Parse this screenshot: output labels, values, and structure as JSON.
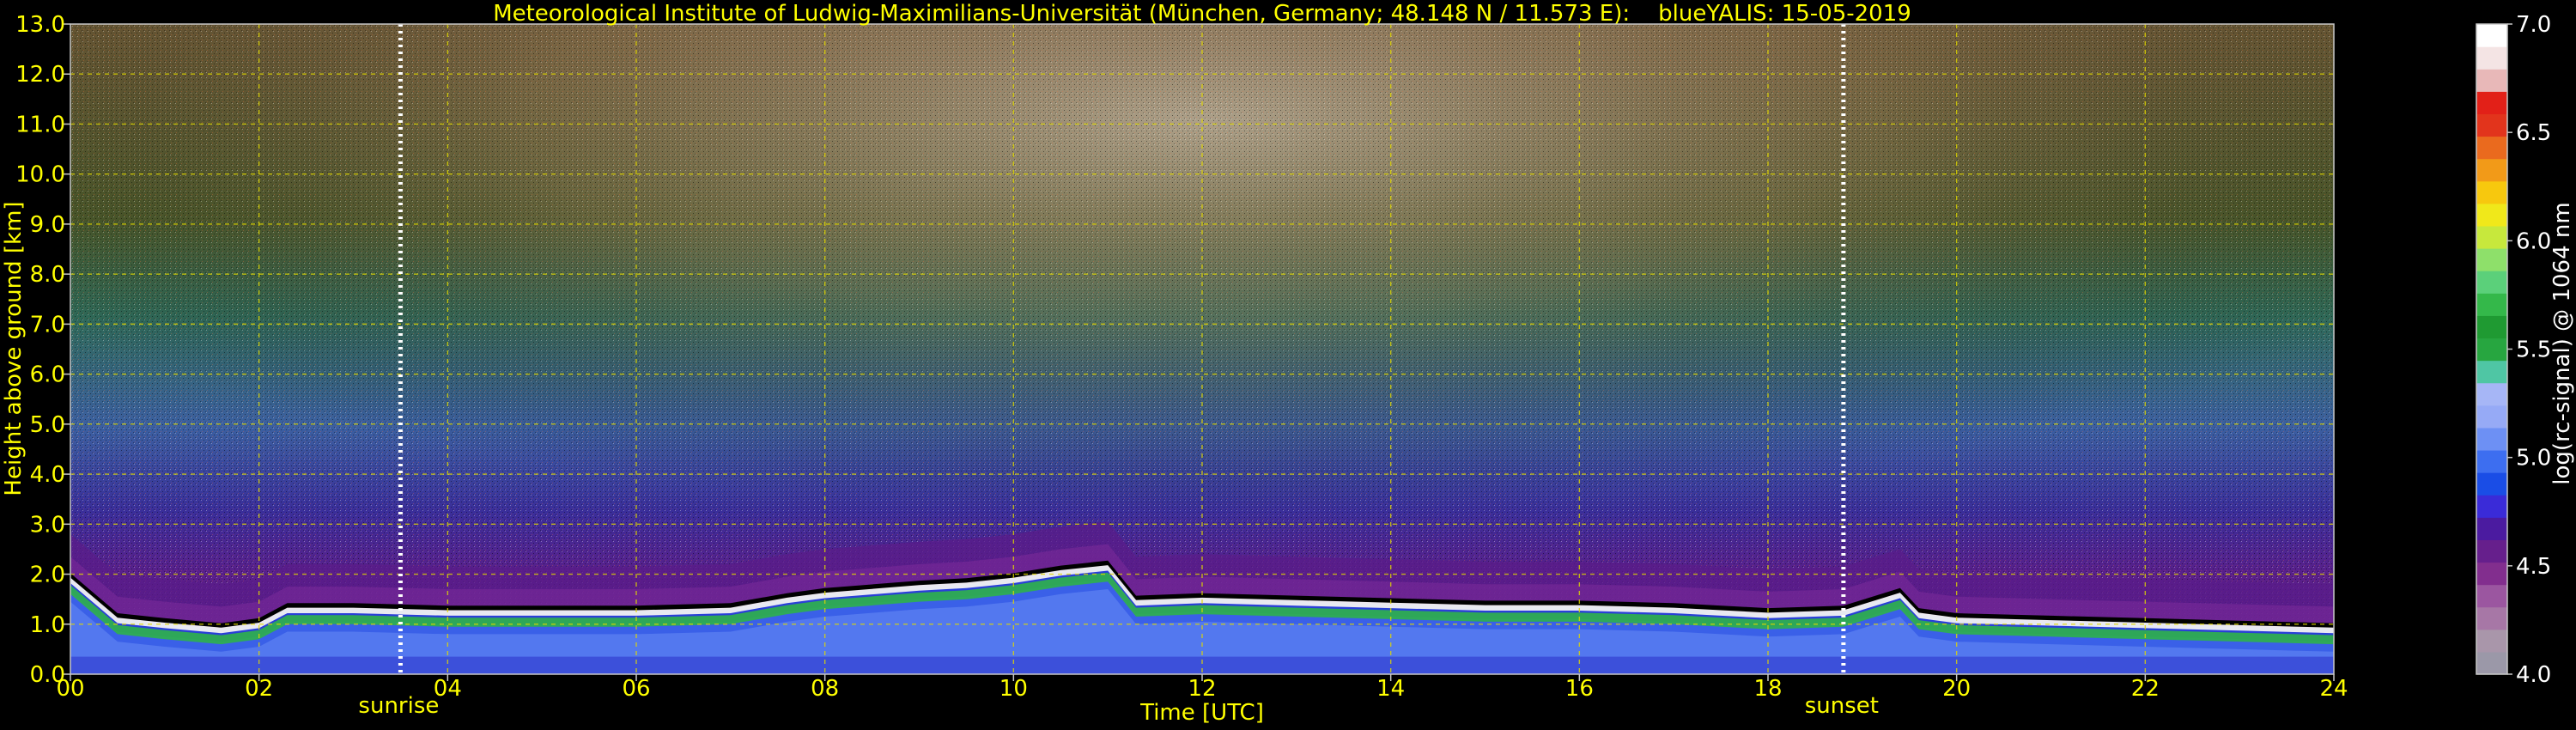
{
  "chart_data": {
    "type": "heatmap",
    "title": "Meteorological Institute of Ludwig-Maximilians-Universität (München, Germany; 48.148 N / 11.573 E):    blueYALIS: 15-05-2019",
    "xlabel": "Time [UTC]",
    "ylabel": "Height above ground [km]",
    "xlim": [
      0,
      24
    ],
    "ylim": [
      0,
      13
    ],
    "x_ticks": [
      "00",
      "02",
      "04",
      "06",
      "08",
      "10",
      "12",
      "14",
      "16",
      "18",
      "20",
      "22",
      "24"
    ],
    "y_ticks": [
      "0.0",
      "1.0",
      "2.0",
      "3.0",
      "4.0",
      "5.0",
      "6.0",
      "7.0",
      "8.0",
      "9.0",
      "10.0",
      "11.0",
      "12.0",
      "13.0"
    ],
    "grid": true,
    "annotations": [
      {
        "text": "sunrise",
        "time": 3.5
      },
      {
        "text": "sunset",
        "time": 18.8
      }
    ],
    "boundary_layer_top_km": [
      [
        0.0,
        1.9
      ],
      [
        0.5,
        1.1
      ],
      [
        1.0,
        1.0
      ],
      [
        1.6,
        0.9
      ],
      [
        2.0,
        1.0
      ],
      [
        2.3,
        1.3
      ],
      [
        3.0,
        1.3
      ],
      [
        4.0,
        1.25
      ],
      [
        5.0,
        1.25
      ],
      [
        6.0,
        1.25
      ],
      [
        7.0,
        1.3
      ],
      [
        7.6,
        1.5
      ],
      [
        8.0,
        1.6
      ],
      [
        9.0,
        1.75
      ],
      [
        9.5,
        1.8
      ],
      [
        10.0,
        1.9
      ],
      [
        10.5,
        2.05
      ],
      [
        11.0,
        2.15
      ],
      [
        11.3,
        1.45
      ],
      [
        12.0,
        1.5
      ],
      [
        13.0,
        1.45
      ],
      [
        14.0,
        1.4
      ],
      [
        15.0,
        1.35
      ],
      [
        16.0,
        1.35
      ],
      [
        17.0,
        1.3
      ],
      [
        18.0,
        1.2
      ],
      [
        18.8,
        1.25
      ],
      [
        19.4,
        1.6
      ],
      [
        19.6,
        1.2
      ],
      [
        20.0,
        1.1
      ],
      [
        21.0,
        1.05
      ],
      [
        22.0,
        1.0
      ],
      [
        23.0,
        0.95
      ],
      [
        24.0,
        0.9
      ]
    ],
    "colorbar": {
      "label": "log(rc-signal) @ 1064 nm",
      "range": [
        4.0,
        7.0
      ],
      "ticks": [
        "4.0",
        "4.5",
        "5.0",
        "5.5",
        "6.0",
        "6.5",
        "7.0"
      ],
      "colors": [
        "#9b98a8",
        "#a996aa",
        "#a777a6",
        "#9b56a0",
        "#822e8e",
        "#661f8c",
        "#4b1ba0",
        "#3a2bd8",
        "#1a4de6",
        "#3d6ef0",
        "#6d90f4",
        "#96aaf6",
        "#a6b6f6",
        "#4fc6a4",
        "#27a640",
        "#1f9a32",
        "#34b84a",
        "#5bd07a",
        "#8ee06a",
        "#c7e83c",
        "#f0e81a",
        "#f7c80e",
        "#f29a18",
        "#ea6a1e",
        "#e2341c",
        "#e22018",
        "#e8b8b8",
        "#f4e4e4",
        "#ffffff"
      ]
    }
  }
}
